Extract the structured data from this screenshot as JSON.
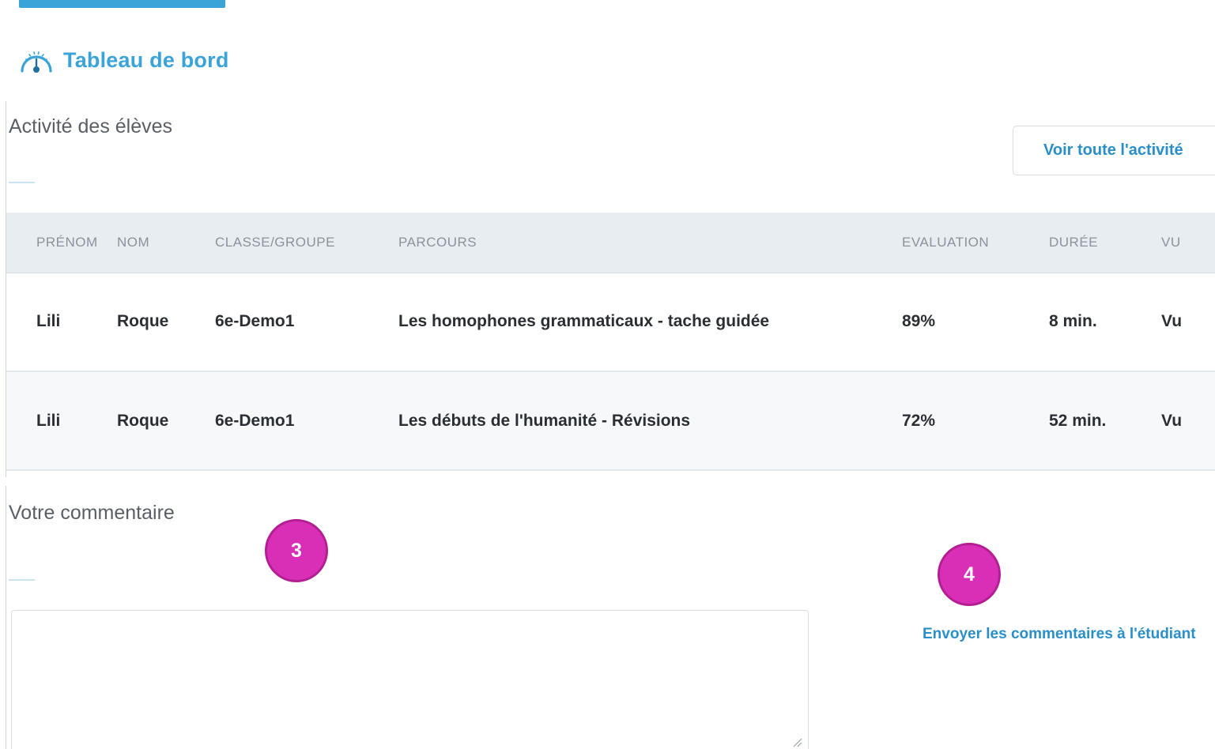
{
  "header": {
    "title": "Tableau de bord",
    "icon": "speedometer-icon",
    "accent_color": "#3aa3d8"
  },
  "activity": {
    "heading": "Activité des élèves",
    "view_all_button": "Voir toute l'activité",
    "columns": [
      "PRÉNOM",
      "NOM",
      "CLASSE/GROUPE",
      "PARCOURS",
      "EVALUATION",
      "DURÉE",
      "VU"
    ],
    "rows": [
      {
        "prenom": "Lili",
        "nom": "Roque",
        "classe": "6e-Demo1",
        "parcours": "Les homophones grammaticaux - tache guidée",
        "evaluation": "89%",
        "duree": "8 min.",
        "vu": "Vu"
      },
      {
        "prenom": "Lili",
        "nom": "Roque",
        "classe": "6e-Demo1",
        "parcours": "Les débuts de l'humanité - Révisions",
        "evaluation": "72%",
        "duree": "52 min.",
        "vu": "Vu"
      }
    ]
  },
  "comment": {
    "heading": "Votre commentaire",
    "textarea_value": "",
    "send_link": "Envoyer les commentaires à l'étudiant"
  },
  "annotations": {
    "badge_3": "3",
    "badge_4": "4",
    "badge_color": "#d92fb6"
  }
}
